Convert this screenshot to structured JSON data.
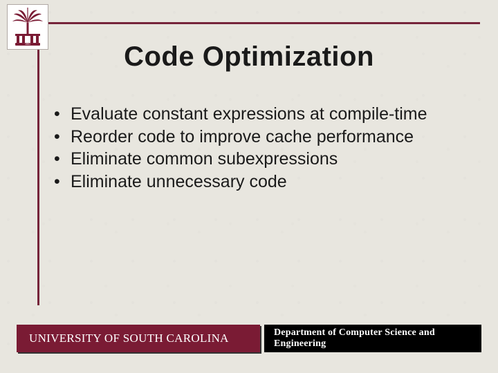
{
  "title": "Code Optimization",
  "bullets": [
    "Evaluate constant expressions at compile-time",
    "Reorder code to improve cache performance",
    "Eliminate common subexpressions",
    "Eliminate unnecessary code"
  ],
  "footer": {
    "left": "UNIVERSITY OF SOUTH CAROLINA",
    "right": "Department of Computer Science and Engineering"
  },
  "colors": {
    "garnet": "#7a1b34",
    "frame": "#76243a"
  }
}
